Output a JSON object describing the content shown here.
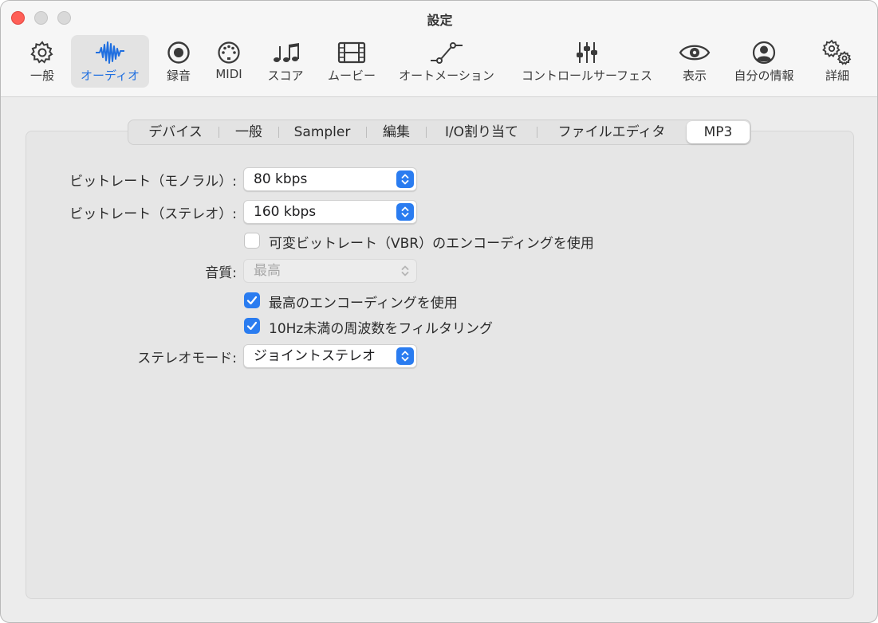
{
  "window": {
    "title": "設定"
  },
  "toolbar": {
    "items": [
      {
        "label": "一般",
        "icon": "gear-icon"
      },
      {
        "label": "オーディオ",
        "icon": "waveform-icon",
        "selected": true
      },
      {
        "label": "録音",
        "icon": "record-icon"
      },
      {
        "label": "MIDI",
        "icon": "midi-port-icon"
      },
      {
        "label": "スコア",
        "icon": "notes-icon"
      },
      {
        "label": "ムービー",
        "icon": "film-icon"
      },
      {
        "label": "オートメーション",
        "icon": "automation-icon"
      },
      {
        "label": "コントロールサーフェス",
        "icon": "sliders-icon"
      },
      {
        "label": "表示",
        "icon": "eye-icon"
      },
      {
        "label": "自分の情報",
        "icon": "person-icon"
      },
      {
        "label": "詳細",
        "icon": "gears-icon"
      }
    ]
  },
  "tabs": [
    {
      "label": "デバイス"
    },
    {
      "label": "一般"
    },
    {
      "label": "Sampler"
    },
    {
      "label": "編集"
    },
    {
      "label": "I/O割り当て"
    },
    {
      "label": "ファイルエディタ"
    },
    {
      "label": "MP3",
      "active": true
    }
  ],
  "settings": {
    "bitrate_mono": {
      "label": "ビットレート（モノラル）:",
      "value": "80 kbps"
    },
    "bitrate_stereo": {
      "label": "ビットレート（ステレオ）:",
      "value": "160 kbps"
    },
    "vbr": {
      "label": "可変ビットレート（VBR）のエンコーディングを使用",
      "checked": false
    },
    "quality": {
      "label": "音質:",
      "value": "最高",
      "disabled": true
    },
    "best_encoding": {
      "label": "最高のエンコーディングを使用",
      "checked": true
    },
    "filter_10hz": {
      "label": "10Hz未満の周波数をフィルタリング",
      "checked": true
    },
    "stereo_mode": {
      "label": "ステレオモード:",
      "value": "ジョイントステレオ"
    }
  },
  "colors": {
    "accent": "#2a7cf0",
    "close": "#ff5f57"
  }
}
